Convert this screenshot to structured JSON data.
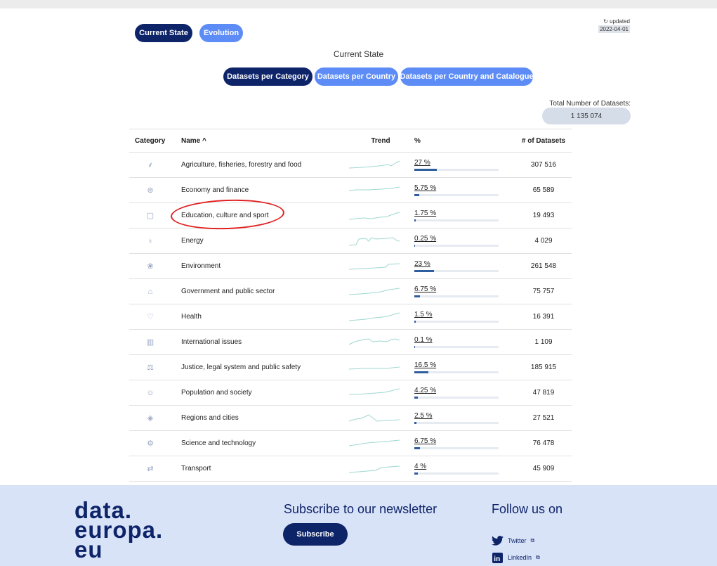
{
  "views": {
    "current_state": "Current State",
    "evolution": "Evolution"
  },
  "updated": {
    "label": "↻ updated",
    "date": "2022-04-01"
  },
  "section_title": "Current State",
  "subtabs": [
    "Datasets per Category",
    "Datasets per Country",
    "Datasets per Country and Catalogue"
  ],
  "total": {
    "label": "Total Number of Datasets:",
    "value": "1 135 074"
  },
  "columns": {
    "category": "Category",
    "name": "Name ^",
    "trend": "Trend",
    "pct": "%",
    "count": "# of Datasets"
  },
  "rows": [
    {
      "icon": "agriculture-icon",
      "name": "Agriculture, fisheries, forestry and food",
      "pct": "27 %",
      "fraction": 0.27,
      "count": "307 516"
    },
    {
      "icon": "economy-icon",
      "name": "Economy and finance",
      "pct": "5.75 %",
      "fraction": 0.0575,
      "count": "65 589"
    },
    {
      "icon": "education-icon",
      "name": "Education, culture and sport",
      "pct": "1.75 %",
      "fraction": 0.0175,
      "count": "19 493"
    },
    {
      "icon": "energy-icon",
      "name": "Energy",
      "pct": "0.25 %",
      "fraction": 0.0025,
      "count": "4 029"
    },
    {
      "icon": "environment-icon",
      "name": "Environment",
      "pct": "23 %",
      "fraction": 0.23,
      "count": "261 548"
    },
    {
      "icon": "government-icon",
      "name": "Government and public sector",
      "pct": "6.75 %",
      "fraction": 0.0675,
      "count": "75 757"
    },
    {
      "icon": "health-icon",
      "name": "Health",
      "pct": "1.5 %",
      "fraction": 0.015,
      "count": "16 391"
    },
    {
      "icon": "international-icon",
      "name": "International issues",
      "pct": "0.1 %",
      "fraction": 0.001,
      "count": "1 109"
    },
    {
      "icon": "justice-icon",
      "name": "Justice, legal system and public safety",
      "pct": "16.5 %",
      "fraction": 0.165,
      "count": "185 915"
    },
    {
      "icon": "population-icon",
      "name": "Population and society",
      "pct": "4.25 %",
      "fraction": 0.0425,
      "count": "47 819"
    },
    {
      "icon": "regions-icon",
      "name": "Regions and cities",
      "pct": "2.5 %",
      "fraction": 0.025,
      "count": "27 521"
    },
    {
      "icon": "science-icon",
      "name": "Science and technology",
      "pct": "6.75 %",
      "fraction": 0.0675,
      "count": "76 478"
    },
    {
      "icon": "transport-icon",
      "name": "Transport",
      "pct": "4 %",
      "fraction": 0.04,
      "count": "45 909"
    }
  ],
  "footer": {
    "logo": [
      "data.",
      "europa.",
      "eu"
    ],
    "subscribe_title": "Subscribe to our newsletter",
    "subscribe_button": "Subscribe",
    "follow_title": "Follow us on",
    "twitter": "Twitter",
    "linkedin": "LinkedIn"
  },
  "colors": {
    "dark_blue": "#0e2469",
    "light_blue": "#5d8cf6",
    "bar": "#2e5e9e",
    "trend": "#9fd8d0",
    "annotation": "#e02020"
  }
}
